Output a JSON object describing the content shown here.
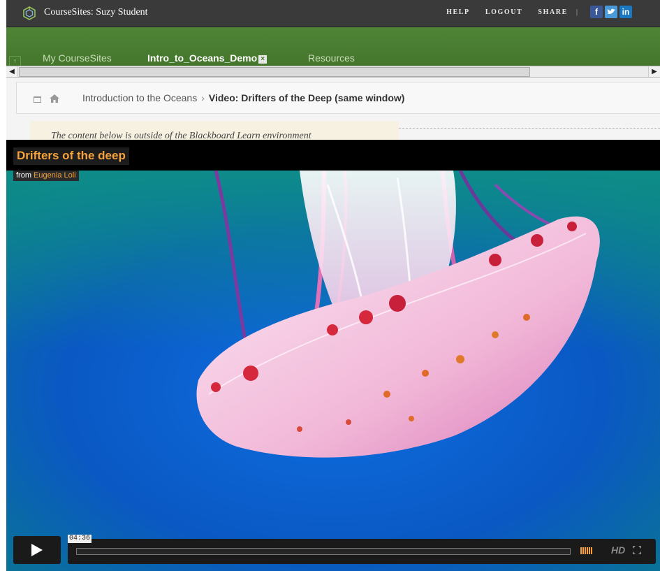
{
  "header": {
    "site_title": "CourseSites: Suzy Student",
    "links": [
      "HELP",
      "LOGOUT",
      "SHARE"
    ],
    "separator": "|",
    "social": [
      "f",
      "t",
      "in"
    ]
  },
  "tabs": [
    {
      "label": "My CourseSites",
      "active": false
    },
    {
      "label": "Intro_to_Oceans_Demo",
      "active": true
    },
    {
      "label": "Resources",
      "active": false
    }
  ],
  "breadcrumb": {
    "parent": "Introduction to the Oceans",
    "separator": "›",
    "current": "Video: Drifters of the Deep (same window)"
  },
  "notice": {
    "text": "The content below is outside of the Blackboard Learn environment"
  },
  "video": {
    "title": "Drifters of the deep",
    "from_label": "from",
    "author": "Eugenia Loli",
    "timecode": "04:36",
    "hd_label": "HD",
    "played_fraction": 0
  },
  "colors": {
    "topbar": "#3a3a3a",
    "tabbar": "#4a7e32",
    "accent_orange": "#f6a13a",
    "ocean_blue": "#0a5fcf"
  }
}
